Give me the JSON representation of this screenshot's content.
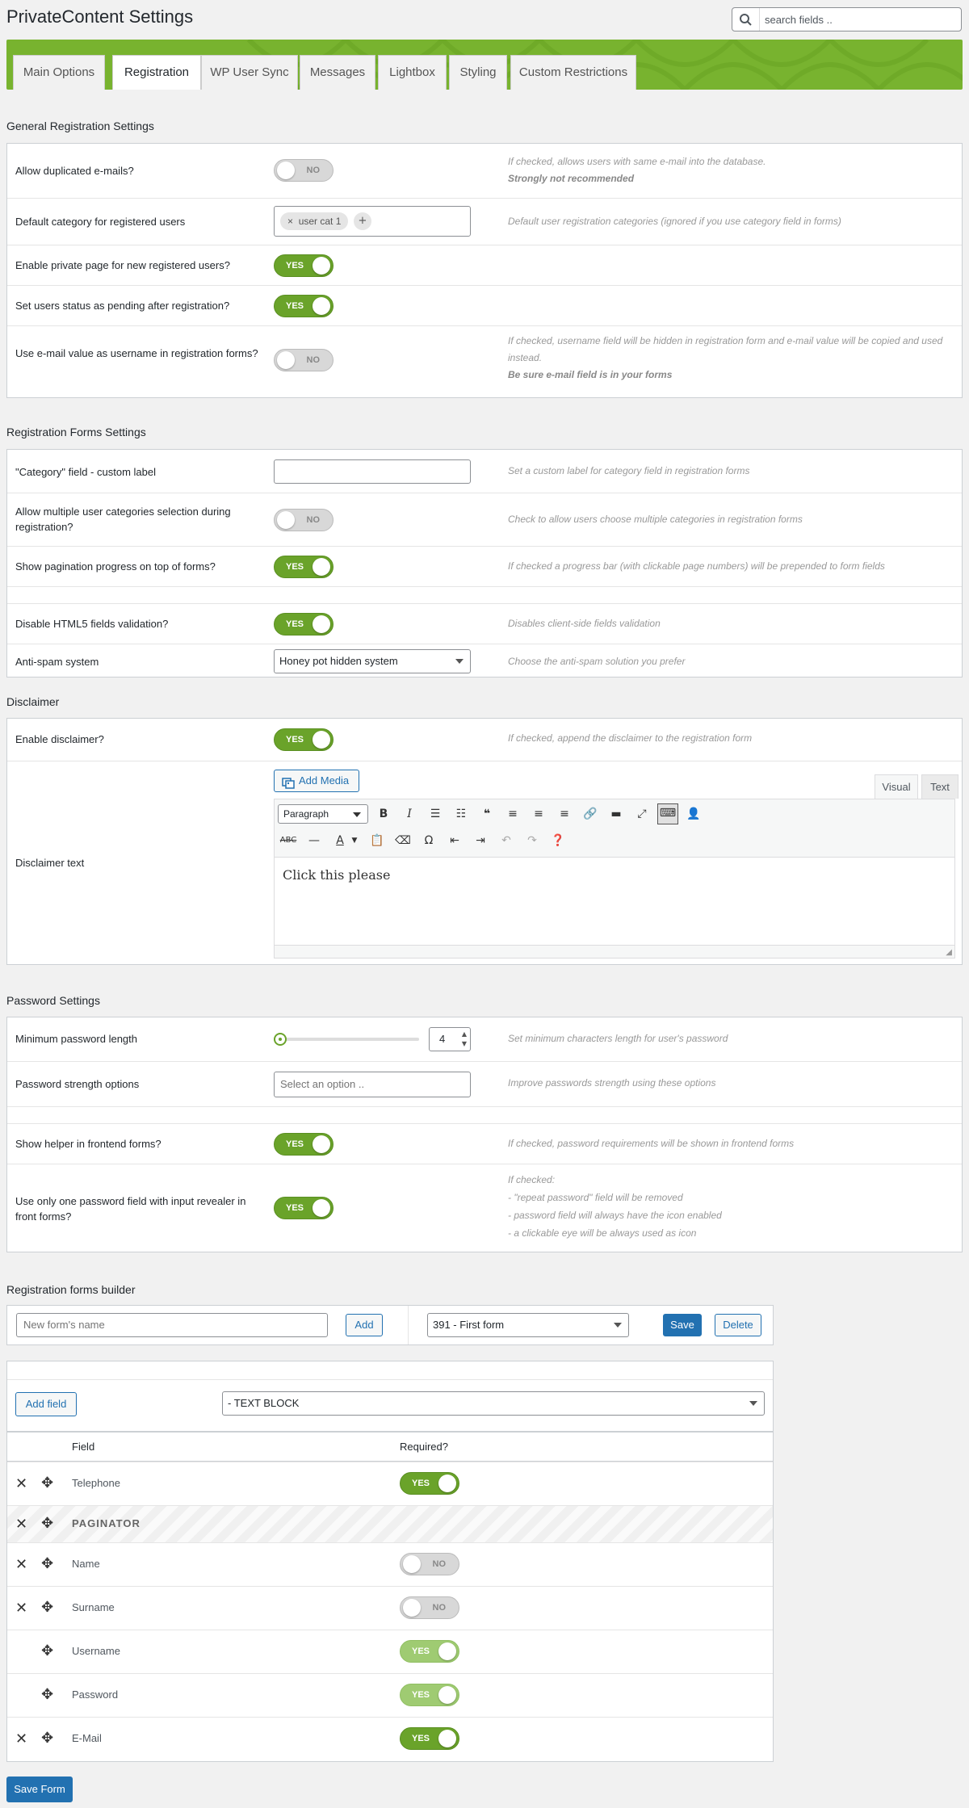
{
  "page": {
    "title": "PrivateContent Settings",
    "search_placeholder": "search fields .."
  },
  "tabs": [
    "Main Options",
    "Registration",
    "WP User Sync",
    "Messages",
    "Lightbox",
    "Styling",
    "Custom Restrictions"
  ],
  "general": {
    "title": "General Registration Settings",
    "dup_label": "Allow duplicated e-mails?",
    "dup_toggle": "NO",
    "dup_note1": "If checked, allows users with same e-mail into the database.",
    "dup_note2": "Strongly not recommended",
    "cat_label": "Default category for registered users",
    "cat_chip": "user cat 1",
    "cat_chip_remove": "×",
    "cat_add": "+",
    "cat_note": "Default user registration categories (ignored if you use category field in forms)",
    "private_label": "Enable private page for new registered users?",
    "private_toggle": "YES",
    "pending_label": "Set users status as pending after registration?",
    "pending_toggle": "YES",
    "email_label": "Use e-mail value as username in registration forms?",
    "email_toggle": "NO",
    "email_note1": "If checked, username field will be hidden in registration form and e-mail value will be copied and used instead.",
    "email_note2": "Be sure e-mail field is in your forms"
  },
  "forms": {
    "title": "Registration Forms Settings",
    "catlabel_label": "\"Category\" field - custom label",
    "catlabel_value": "",
    "catlabel_note": "Set a custom label for category field in registration forms",
    "multi_label": "Allow multiple user categories selection during registration?",
    "multi_toggle": "NO",
    "multi_note": "Check to allow users choose multiple categories in registration forms",
    "pag_label": "Show pagination progress on top of forms?",
    "pag_toggle": "YES",
    "pag_note": "If checked a progress bar (with clickable page numbers) will be prepended to form fields",
    "html5_label": "Disable HTML5 fields validation?",
    "html5_toggle": "YES",
    "html5_note": "Disables client-side fields validation",
    "spam_label": "Anti-spam system",
    "spam_value": "Honey pot hidden system",
    "spam_note": "Choose the anti-spam solution you prefer"
  },
  "disclaimer": {
    "title": "Disclaimer",
    "enable_label": "Enable disclaimer?",
    "enable_toggle": "YES",
    "enable_note": "If checked, append the disclaimer to the registration form",
    "text_label": "Disclaimer text",
    "add_media": "Add Media",
    "tab_visual": "Visual",
    "tab_text": "Text",
    "paragraph": "Paragraph",
    "content": "Click this please"
  },
  "password": {
    "title": "Password Settings",
    "min_label": "Minimum password length",
    "min_value": "4",
    "min_note": "Set minimum characters length for user's password",
    "min_fraction": 0.0,
    "strength_label": "Password strength options",
    "strength_placeholder": "Select an option ..",
    "strength_note": "Improve passwords strength using these options",
    "helper_label": "Show helper in frontend forms?",
    "helper_toggle": "YES",
    "helper_note": "If checked, password requirements will be shown in frontend forms",
    "single_label": "Use only one password field with input revealer in front forms?",
    "single_toggle": "YES",
    "single_note": [
      "If checked:",
      "- \"repeat password\" field will be removed",
      "- password field will always have the icon enabled",
      "- a clickable eye will be always used as icon"
    ]
  },
  "builder": {
    "title": "Registration forms builder",
    "new_placeholder": "New form's name",
    "add": "Add",
    "form_select": "391 - First form",
    "save": "Save",
    "delete": "Delete",
    "add_field": "Add field",
    "field_select": "- TEXT BLOCK",
    "col_field": "Field",
    "col_required": "Required?",
    "rows": [
      {
        "name": "Telephone",
        "required": "YES"
      },
      {
        "name": "PAGINATOR"
      },
      {
        "name": "Name",
        "required": "NO"
      },
      {
        "name": "Surname",
        "required": "NO"
      },
      {
        "name": "Username",
        "required": "YES"
      },
      {
        "name": "Password",
        "required": "YES"
      },
      {
        "name": "E-Mail",
        "required": "YES"
      }
    ],
    "save_form": "Save Form"
  }
}
